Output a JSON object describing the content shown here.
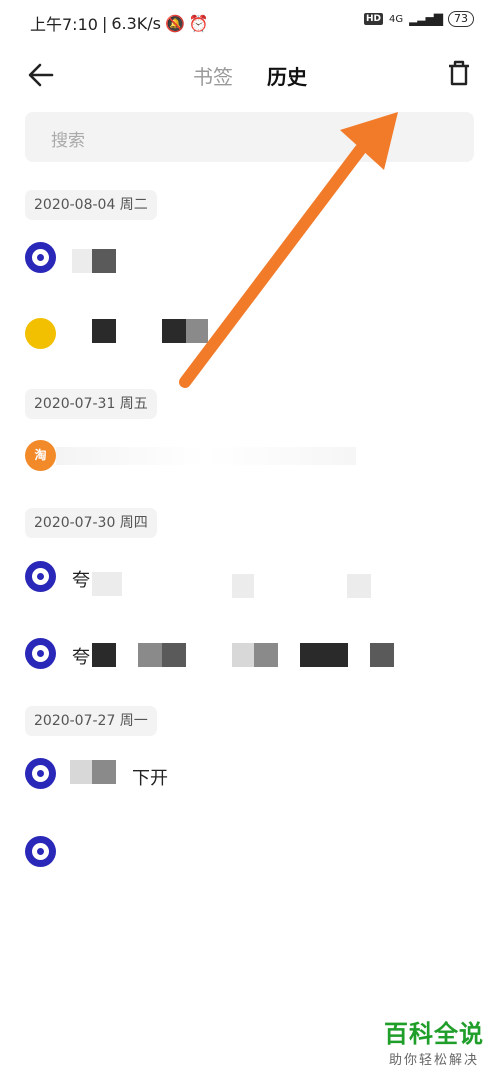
{
  "status": {
    "time": "上午7:10",
    "speed": "6.3K/s",
    "hd": "HD",
    "net": "4G",
    "battery": "73"
  },
  "header": {
    "tab_bookmarks": "书签",
    "tab_history": "历史"
  },
  "search": {
    "placeholder": "搜索"
  },
  "groups": [
    {
      "date": "2020-08-04 周二"
    },
    {
      "date": "2020-07-31 周五"
    },
    {
      "date": "2020-07-30 周四"
    },
    {
      "date": "2020-07-27 周一"
    }
  ],
  "items": {
    "item4_prefix": "夸",
    "item5_prefix": "夸",
    "item6_suffix": "下开",
    "item3_icon_text": "淘"
  },
  "arrow_color": "#f27b2a",
  "watermark": {
    "main": "百科全说",
    "sub": "助你轻松解决"
  }
}
